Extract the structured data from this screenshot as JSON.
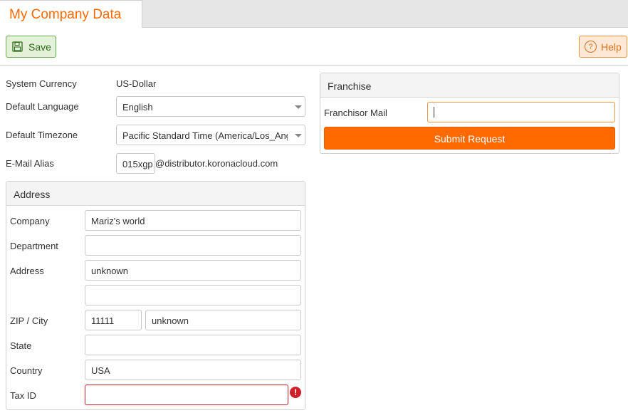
{
  "tab": {
    "title": "My Company Data"
  },
  "toolbar": {
    "save_label": "Save",
    "help_label": "Help",
    "help_icon_glyph": "?"
  },
  "settings": {
    "system_currency": {
      "label": "System Currency",
      "value": "US-Dollar"
    },
    "default_language": {
      "label": "Default Language",
      "value": "English"
    },
    "default_timezone": {
      "label": "Default Timezone",
      "value": "Pacific Standard Time (America/Los_Angeles)"
    },
    "email_alias": {
      "label": "E-Mail Alias",
      "value": "015xgp",
      "suffix": "@distributor.koronacloud.com"
    }
  },
  "address": {
    "title": "Address",
    "company": {
      "label": "Company",
      "value": "Mariz's world"
    },
    "department": {
      "label": "Department",
      "value": ""
    },
    "address": {
      "label": "Address",
      "line1": "unknown",
      "line2": ""
    },
    "zip_city": {
      "label": "ZIP / City",
      "zip": "11111",
      "city": "unknown"
    },
    "state": {
      "label": "State",
      "value": ""
    },
    "country": {
      "label": "Country",
      "value": "USA"
    },
    "tax_id": {
      "label": "Tax ID",
      "value": "",
      "error_glyph": "!"
    }
  },
  "franchise": {
    "title": "Franchise",
    "mail_label": "Franchisor Mail",
    "mail_value": "",
    "submit_label": "Submit Request"
  },
  "colors": {
    "accent": "#ff6a00",
    "save_bg": "#e2f1d7",
    "help_bg": "#ffe9d6",
    "error": "#d0202a"
  },
  "icons": {
    "save": "floppy-disk-icon",
    "help": "question-circle-icon",
    "error": "exclamation-circle-icon"
  }
}
